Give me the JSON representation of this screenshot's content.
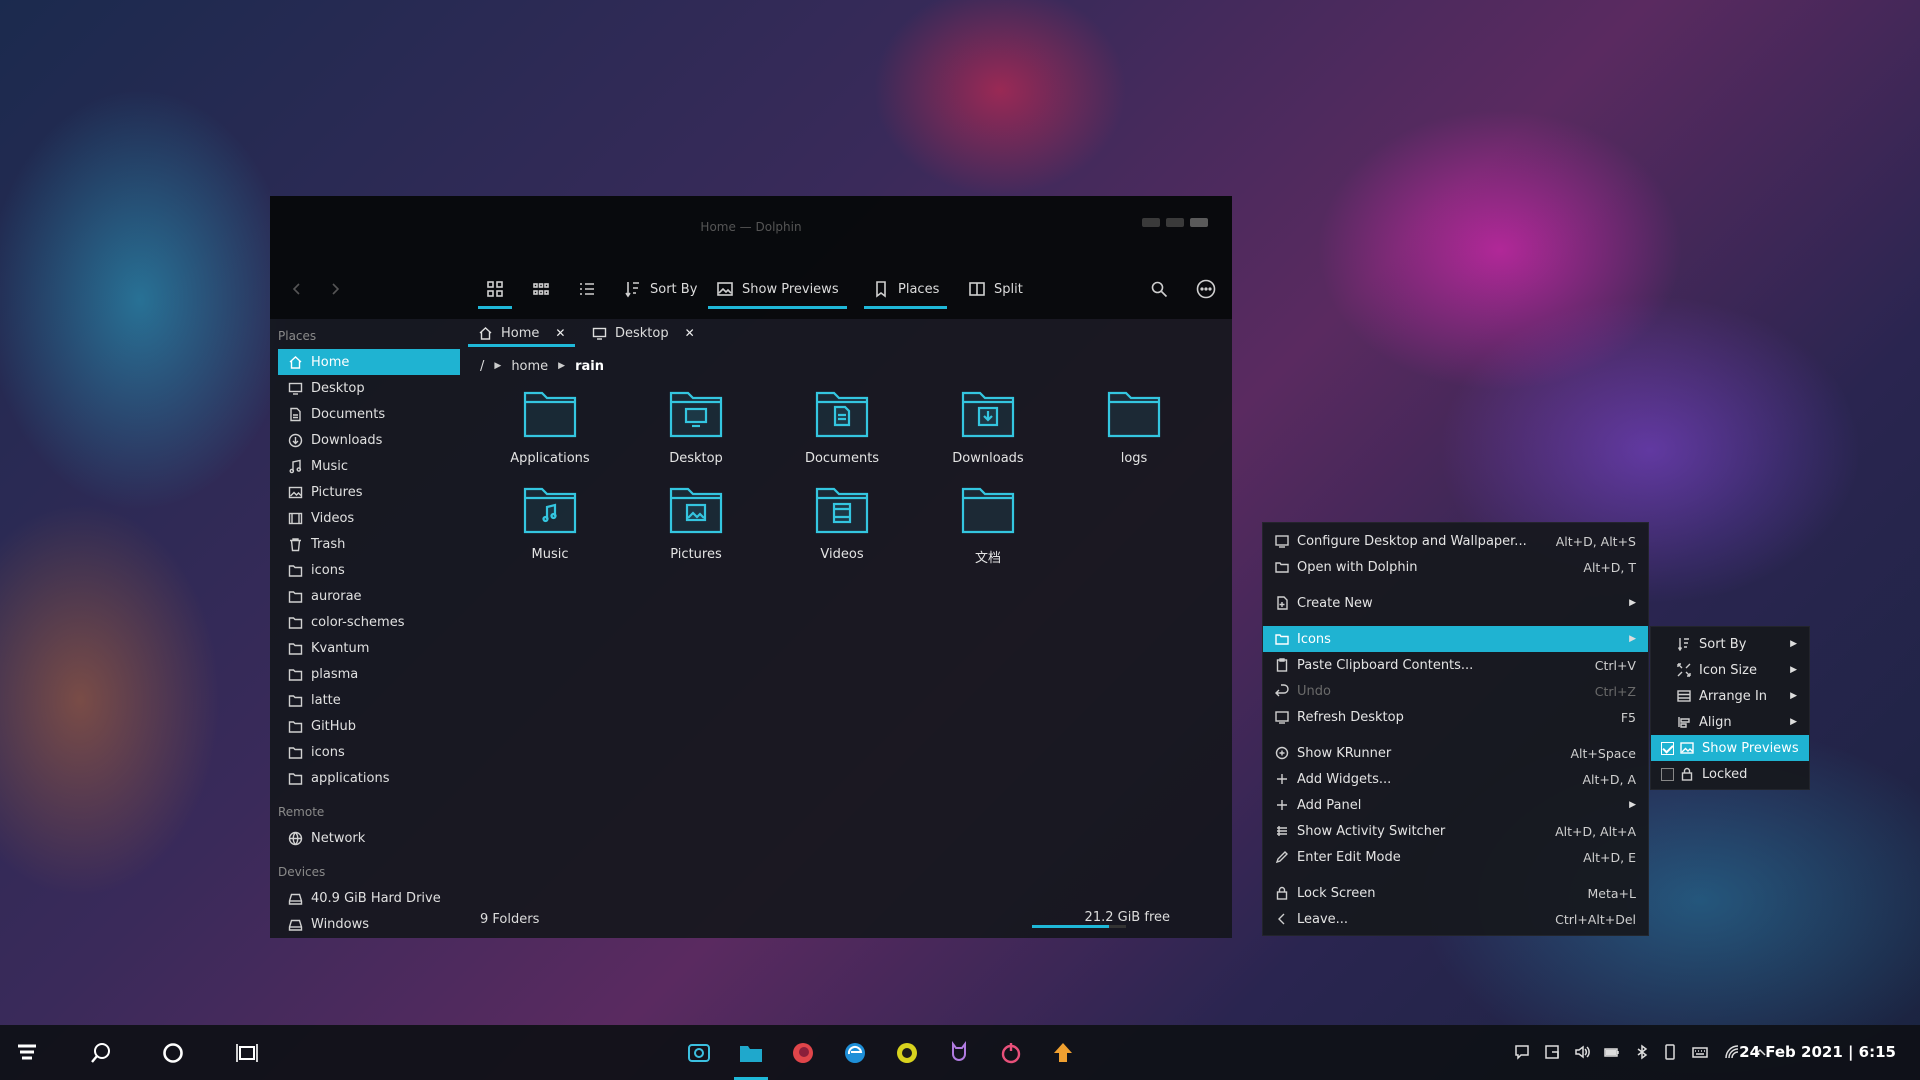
{
  "window": {
    "title": "Home — Dolphin"
  },
  "toolbar": {
    "sort_by": "Sort By",
    "show_previews": "Show Previews",
    "places": "Places",
    "split": "Split"
  },
  "sidebar": {
    "places_header": "Places",
    "places": [
      {
        "label": "Home",
        "icon": "home-icon"
      },
      {
        "label": "Desktop",
        "icon": "desktop-icon"
      },
      {
        "label": "Documents",
        "icon": "document-icon"
      },
      {
        "label": "Downloads",
        "icon": "download-icon"
      },
      {
        "label": "Music",
        "icon": "music-icon"
      },
      {
        "label": "Pictures",
        "icon": "picture-icon"
      },
      {
        "label": "Videos",
        "icon": "video-icon"
      },
      {
        "label": "Trash",
        "icon": "trash-icon"
      },
      {
        "label": "icons",
        "icon": "folder-icon"
      },
      {
        "label": "aurorae",
        "icon": "folder-icon"
      },
      {
        "label": "color-schemes",
        "icon": "folder-icon"
      },
      {
        "label": "Kvantum",
        "icon": "folder-icon"
      },
      {
        "label": "plasma",
        "icon": "folder-icon"
      },
      {
        "label": "latte",
        "icon": "folder-icon"
      },
      {
        "label": "GitHub",
        "icon": "folder-icon"
      },
      {
        "label": "icons",
        "icon": "folder-icon"
      },
      {
        "label": "applications",
        "icon": "folder-icon"
      }
    ],
    "remote_header": "Remote",
    "remote": [
      {
        "label": "Network",
        "icon": "network-icon"
      }
    ],
    "devices_header": "Devices",
    "devices": [
      {
        "label": "40.9 GiB Hard Drive",
        "icon": "drive-icon"
      },
      {
        "label": "Windows",
        "icon": "drive-icon"
      }
    ]
  },
  "tabs": [
    {
      "label": "Home"
    },
    {
      "label": "Desktop"
    }
  ],
  "breadcrumb": {
    "root": "/",
    "home": "home",
    "current": "rain"
  },
  "files": [
    {
      "label": "Applications",
      "icon": "folder-icon"
    },
    {
      "label": "Desktop",
      "icon": "folder-desktop-icon"
    },
    {
      "label": "Documents",
      "icon": "folder-documents-icon"
    },
    {
      "label": "Downloads",
      "icon": "folder-downloads-icon"
    },
    {
      "label": "logs",
      "icon": "folder-icon"
    },
    {
      "label": "Music",
      "icon": "folder-music-icon"
    },
    {
      "label": "Pictures",
      "icon": "folder-pictures-icon"
    },
    {
      "label": "Videos",
      "icon": "folder-videos-icon"
    },
    {
      "label": "文档",
      "icon": "folder-icon"
    }
  ],
  "status": {
    "count": "9 Folders",
    "free": "21.2 GiB free",
    "used_fraction": 0.82
  },
  "context_menu": {
    "items": [
      {
        "label": "Configure Desktop and Wallpaper...",
        "shortcut": "Alt+D, Alt+S"
      },
      {
        "label": "Open with Dolphin",
        "shortcut": "Alt+D, T"
      },
      {
        "label": "Create New",
        "shortcut": ""
      },
      {
        "label": "Icons",
        "shortcut": ""
      },
      {
        "label": "Paste Clipboard Contents...",
        "shortcut": "Ctrl+V"
      },
      {
        "label": "Undo",
        "shortcut": "Ctrl+Z"
      },
      {
        "label": "Refresh Desktop",
        "shortcut": "F5"
      },
      {
        "label": "Show KRunner",
        "shortcut": "Alt+Space"
      },
      {
        "label": "Add Widgets...",
        "shortcut": "Alt+D, A"
      },
      {
        "label": "Add Panel",
        "shortcut": ""
      },
      {
        "label": "Show Activity Switcher",
        "shortcut": "Alt+D, Alt+A"
      },
      {
        "label": "Enter Edit Mode",
        "shortcut": "Alt+D, E"
      },
      {
        "label": "Lock Screen",
        "shortcut": "Meta+L"
      },
      {
        "label": "Leave...",
        "shortcut": "Ctrl+Alt+Del"
      }
    ]
  },
  "icons_submenu": {
    "items": [
      {
        "label": "Sort By"
      },
      {
        "label": "Icon Size"
      },
      {
        "label": "Arrange In"
      },
      {
        "label": "Align"
      },
      {
        "label": "Show Previews",
        "checked": true
      },
      {
        "label": "Locked",
        "checked": false
      }
    ]
  },
  "taskbar": {
    "clock": "24 Feb 2021 | 6:15"
  },
  "colors": {
    "accent": "#1fb3d2"
  }
}
